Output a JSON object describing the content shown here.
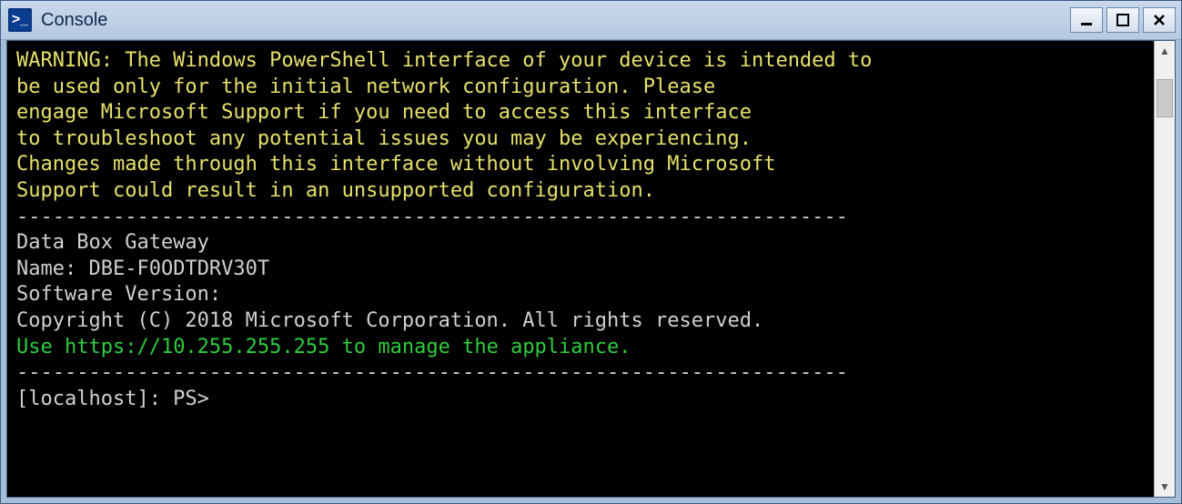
{
  "window": {
    "title": "Console"
  },
  "terminal": {
    "warning_lines": [
      "WARNING: The Windows PowerShell interface of your device is intended to",
      "be used only for the initial network configuration. Please",
      "engage Microsoft Support if you need to access this interface",
      "to troubleshoot any potential issues you may be experiencing.",
      "Changes made through this interface without involving Microsoft",
      "Support could result in an unsupported configuration."
    ],
    "separator": "---------------------------------------------------------------------",
    "product": "Data Box Gateway",
    "name_label": "Name:",
    "name_value": "DBE-F0ODTDRV30T",
    "sw_label": "Software Version:",
    "copyright": "Copyright (C) 2018 Microsoft Corporation. All rights reserved.",
    "manage_prefix": "Use ",
    "manage_url": "https://10.255.255.255",
    "manage_suffix": " to manage the appliance.",
    "prompt": "[localhost]: PS>"
  }
}
